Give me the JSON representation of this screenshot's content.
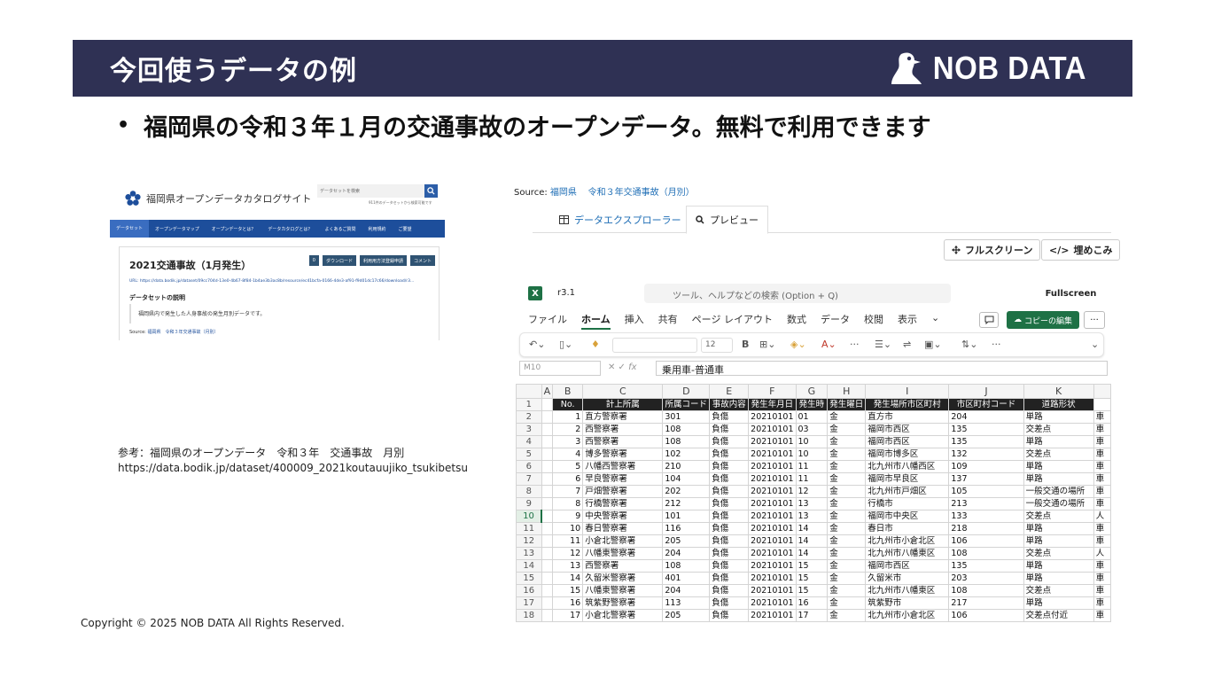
{
  "slide": {
    "title": "今回使うデータの例",
    "logo_text": "NOB DATA",
    "bullet": "福岡県の令和３年１月の交通事故のオープンデータ。無料で利用できます",
    "reference_line1": "参考：福岡県のオープンデータ　令和３年　交通事故　月別",
    "reference_line2": "https://data.bodik.jp/dataset/400009_2021koutauujiko_tsukibetsu",
    "copyright": "Copyright © 2025 NOB DATA All Rights Reserved."
  },
  "site": {
    "name": "福岡県オープンデータカタログサイト",
    "search_placeholder": "データセットを検索",
    "count_text": "911件のデータセットから検索可能です",
    "nav": [
      "データセット",
      "オープンデータマップ",
      "オープンデータとは？",
      "データカタログとは？",
      "よくあるご質問",
      "利用規約",
      "ご要望"
    ],
    "dataset_title": "2021交通事故（1月発生）",
    "buttons": [
      "0",
      "ダウンロード",
      "利用用方法登録申請",
      "コメント"
    ],
    "url": "URL: https://data.bodik.jp/dataset/09cc704d-13e0-4b67-8f84-1b4ae3b3ac8b/resource/ec41bcfa-0166-4de3-af91-f9d01dc17c66/download/r3...",
    "desc_heading": "データセットの説明",
    "desc": "福岡県内で発生した人身事故の発生月別データです。",
    "source_label": "Source:",
    "source_link": "福岡県　令和３年交通事故（月別）"
  },
  "preview": {
    "source_label": "Source:",
    "source_link1": "福岡県",
    "source_link2": "令和３年交通事故（月別）",
    "tab_explorer": "データエクスプローラー",
    "tab_preview": "プレビュー",
    "btn_fullscreen": "フルスクリーン",
    "btn_embed": "埋めこみ"
  },
  "excel": {
    "file_name": "r3.1",
    "search_placeholder": "ツール、ヘルプなどの検索 (Option + Q)",
    "fullscreen": "Fullscreen",
    "menu": [
      "ファイル",
      "ホーム",
      "挿入",
      "共有",
      "ページ レイアウト",
      "数式",
      "データ",
      "校閲",
      "表示"
    ],
    "active_menu": "ホーム",
    "copy_edit": "コピーの編集",
    "font_size": "12",
    "name_box": "M10",
    "formula": "乗用車-普通車",
    "col_letters": [
      "",
      "A",
      "B",
      "C",
      "D",
      "E",
      "F",
      "G",
      "H",
      "I",
      "J",
      "K",
      ""
    ],
    "headers": [
      "No.",
      "計上所属",
      "所属コード",
      "事故内容",
      "発生年月日",
      "発生時",
      "発生曜日",
      "発生場所市区町村",
      "市区町村コード",
      "道路形状",
      ""
    ],
    "rows": [
      [
        "1",
        "直方警察署",
        "301",
        "負傷",
        "20210101",
        "01",
        "金",
        "直方市",
        "204",
        "単路",
        "車"
      ],
      [
        "2",
        "西警察署",
        "108",
        "負傷",
        "20210101",
        "03",
        "金",
        "福岡市西区",
        "135",
        "交差点",
        "車"
      ],
      [
        "3",
        "西警察署",
        "108",
        "負傷",
        "20210101",
        "10",
        "金",
        "福岡市西区",
        "135",
        "単路",
        "車"
      ],
      [
        "4",
        "博多警察署",
        "102",
        "負傷",
        "20210101",
        "10",
        "金",
        "福岡市博多区",
        "132",
        "交差点",
        "車"
      ],
      [
        "5",
        "八幡西警察署",
        "210",
        "負傷",
        "20210101",
        "11",
        "金",
        "北九州市八幡西区",
        "109",
        "単路",
        "車"
      ],
      [
        "6",
        "早良警察署",
        "104",
        "負傷",
        "20210101",
        "11",
        "金",
        "福岡市早良区",
        "137",
        "単路",
        "車"
      ],
      [
        "7",
        "戸畑警察署",
        "202",
        "負傷",
        "20210101",
        "12",
        "金",
        "北九州市戸畑区",
        "105",
        "一般交通の場所",
        "車"
      ],
      [
        "8",
        "行橋警察署",
        "212",
        "負傷",
        "20210101",
        "13",
        "金",
        "行橋市",
        "213",
        "一般交通の場所",
        "車"
      ],
      [
        "9",
        "中央警察署",
        "101",
        "負傷",
        "20210101",
        "13",
        "金",
        "福岡市中央区",
        "133",
        "交差点",
        "人"
      ],
      [
        "10",
        "春日警察署",
        "116",
        "負傷",
        "20210101",
        "14",
        "金",
        "春日市",
        "218",
        "単路",
        "車"
      ],
      [
        "11",
        "小倉北警察署",
        "205",
        "負傷",
        "20210101",
        "14",
        "金",
        "北九州市小倉北区",
        "106",
        "単路",
        "車"
      ],
      [
        "12",
        "八幡東警察署",
        "204",
        "負傷",
        "20210101",
        "14",
        "金",
        "北九州市八幡東区",
        "108",
        "交差点",
        "人"
      ],
      [
        "13",
        "西警察署",
        "108",
        "負傷",
        "20210101",
        "15",
        "金",
        "福岡市西区",
        "135",
        "単路",
        "車"
      ],
      [
        "14",
        "久留米警察署",
        "401",
        "負傷",
        "20210101",
        "15",
        "金",
        "久留米市",
        "203",
        "単路",
        "車"
      ],
      [
        "15",
        "八幡東警察署",
        "204",
        "負傷",
        "20210101",
        "15",
        "金",
        "北九州市八幡東区",
        "108",
        "交差点",
        "車"
      ],
      [
        "16",
        "筑紫野警察署",
        "113",
        "負傷",
        "20210101",
        "16",
        "金",
        "筑紫野市",
        "217",
        "単路",
        "車"
      ],
      [
        "17",
        "小倉北警察署",
        "205",
        "負傷",
        "20210101",
        "17",
        "金",
        "北九州市小倉北区",
        "106",
        "交差点付近",
        "車"
      ]
    ],
    "selected_row": "10"
  },
  "colors": {
    "band": "#2f3154",
    "excel_green": "#1e7145",
    "site_blue": "#1d4e9b"
  }
}
